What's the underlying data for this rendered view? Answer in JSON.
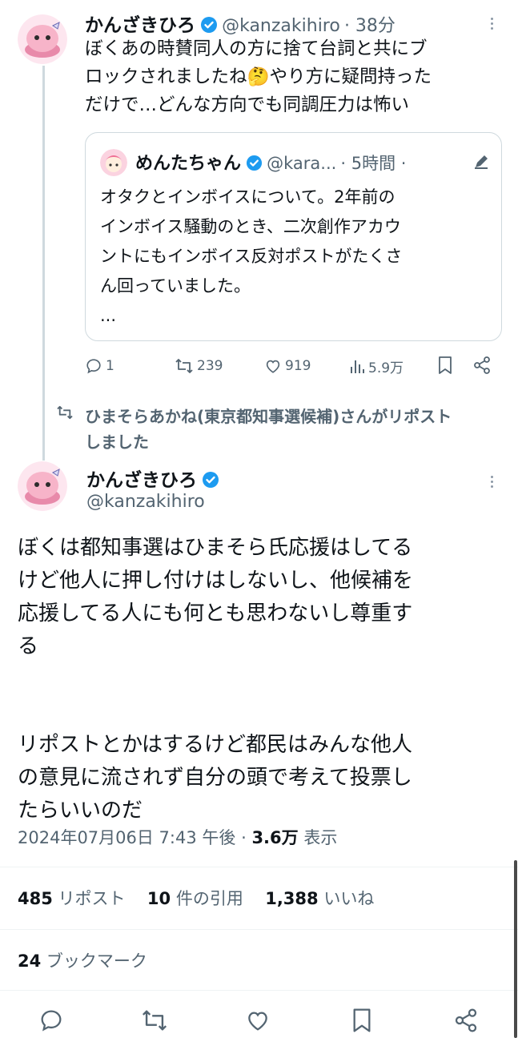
{
  "tweet1": {
    "name": "かんざきひろ",
    "handle": "@kanzakihiro",
    "time": "· 38分",
    "line1": "ぼくあの時賛同人の方に捨て台詞と共にブ",
    "line2a": "ロックされましたね",
    "emoji": "🤔",
    "line2b": "やり方に疑問持った",
    "line3": "だけで…どんな方向でも同調圧力は怖い",
    "quote": {
      "name": "めんたちゃん",
      "handle": "@kara...",
      "time": "· 5時間 ·",
      "lines": [
        "オタクとインボイスについて。2年前の",
        "インボイス騒動のとき、二次創作アカウ",
        "ントにもインボイス反対ポストがたくさ",
        "ん回っていました。",
        "..."
      ]
    },
    "stats": {
      "replies": "1",
      "reposts": "239",
      "likes": "919",
      "views": "5.9万"
    }
  },
  "repost_notice": {
    "line1": "ひまそらあかね(東京都知事選候補)さんがリポスト",
    "line2": "しました"
  },
  "tweet2": {
    "name": "かんざきひろ",
    "handle": "@kanzakihiro",
    "para1": [
      "ぼくは都知事選はひまそら氏応援はしてる",
      "けど他人に押し付けはしないし、他候補を",
      "応援してる人にも何とも思わないし尊重す",
      "る"
    ],
    "para2": [
      "リポストとかはするけど都民はみんな他人",
      "の意見に流されず自分の頭で考えて投票し",
      "たらいいのだ"
    ],
    "timestamp": "2024年07月06日 7:43 午後 ·",
    "views_num": "3.6万",
    "views_label": "表示",
    "reposts_num": "485",
    "reposts_label": "リポスト",
    "quotes_num": "10",
    "quotes_label": "件の引用",
    "likes_num": "1,388",
    "likes_label": "いいね",
    "bookmarks_num": "24",
    "bookmarks_label": "ブックマーク"
  },
  "colors": {
    "verified": "#1d9bf0",
    "secondary": "#536471",
    "border": "#cfd9de"
  },
  "icons": [
    "verified-icon",
    "reply-icon",
    "repost-icon",
    "like-icon",
    "views-icon",
    "bookmark-icon",
    "share-icon",
    "more-icon",
    "edit-icon"
  ]
}
